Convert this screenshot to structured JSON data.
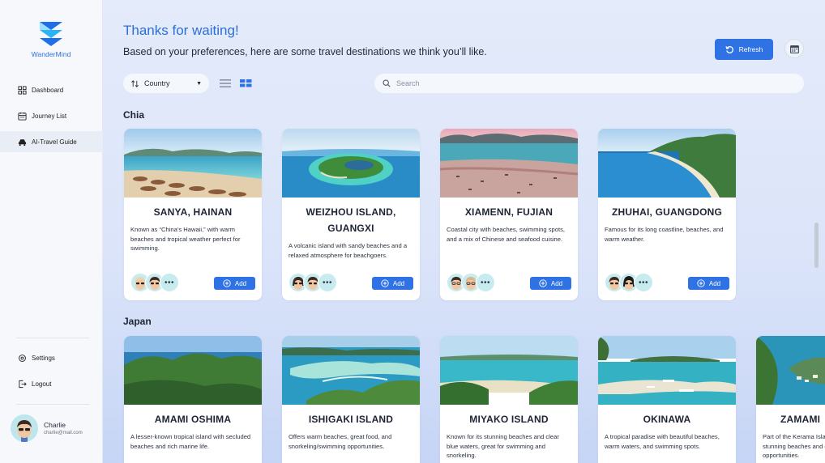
{
  "app": {
    "name": "WanderMind",
    "accent": "#2f72e3"
  },
  "sidebar": {
    "items": [
      {
        "label": "Dashboard",
        "icon": "grid-icon"
      },
      {
        "label": "Journey List",
        "icon": "calendar-list-icon"
      },
      {
        "label": "AI-Travel Guide",
        "icon": "car-icon",
        "active": true
      }
    ],
    "bottom_items": [
      {
        "label": "Settings",
        "icon": "gear-icon"
      },
      {
        "label": "Logout",
        "icon": "logout-icon"
      }
    ],
    "user": {
      "name": "Charlie",
      "email": "charlie@mail.com"
    }
  },
  "header": {
    "title": "Thanks for waiting!",
    "subtitle": "Based on your preferences, here are some travel destinations we think you’ll like.",
    "refresh_label": "Refresh"
  },
  "filters": {
    "country_label": "Country",
    "search_placeholder": "Search",
    "view_mode": "grid"
  },
  "sections": [
    {
      "title": "Chia",
      "cards": [
        {
          "title": "SANYA, HAINAN",
          "description": "Known as “China’s Hawaii,” with warm beaches and tropical weather perfect for swimming.",
          "add_label": "Add",
          "more": "•••"
        },
        {
          "title": "WEIZHOU ISLAND, GUANGXI",
          "description": "A volcanic island with sandy beaches and a relaxed atmosphere for beachgoers.",
          "add_label": "Add",
          "more": "•••"
        },
        {
          "title": "XIAMENN, FUJIAN",
          "description": "Coastal city with beaches, swimming spots, and a mix of Chinese and seafood cuisine.",
          "add_label": "Add",
          "more": "•••"
        },
        {
          "title": "ZHUHAI, GUANGDONG",
          "description": "Famous for its long coastline, beaches, and warm weather.",
          "add_label": "Add",
          "more": "•••"
        }
      ]
    },
    {
      "title": "Japan",
      "cards": [
        {
          "title": "AMAMI OSHIMA",
          "description": "A lesser-known tropical island with secluded beaches and rich marine life."
        },
        {
          "title": "ISHIGAKI ISLAND",
          "description": "Offers warm beaches, great food, and snorkeling/swimming opportunities."
        },
        {
          "title": "MIYAKO ISLAND",
          "description": "Known for its stunning beaches and clear blue waters, great for swimming and snorkeling."
        },
        {
          "title": "OKINAWA",
          "description": "A tropical paradise with beautiful beaches, warm waters, and swimming spots."
        },
        {
          "title": "ZAMAMI",
          "description": "Part of the Kerama Islands, known for its stunning beaches and great swimming opportunities."
        }
      ]
    }
  ]
}
